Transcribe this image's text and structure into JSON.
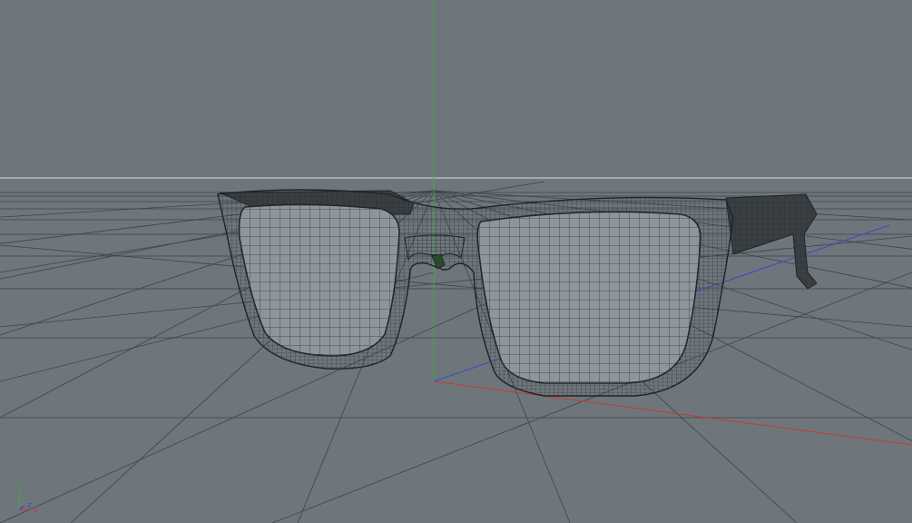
{
  "viewport": {
    "mode": "perspective",
    "background": "#6e767c",
    "grid_color": "#3e4448",
    "horizon_color": "#d8dcdf",
    "axis_colors": {
      "x": "#c43a36",
      "y": "#3fa447",
      "z": "#3b49c2"
    }
  },
  "scene": {
    "object": "sunglasses-wireframe",
    "wire_color": "#2c3135",
    "lens_fill": "#8e959b",
    "temple_fill": "#3a3f43"
  },
  "axis_gizmo": {
    "x_label": "x",
    "y_label": "Y",
    "z_label": "z"
  }
}
